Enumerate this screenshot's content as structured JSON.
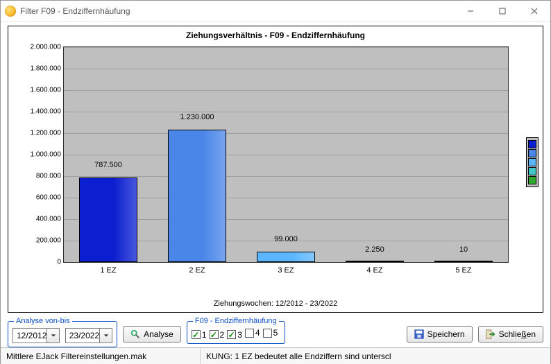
{
  "window": {
    "title": "Filter F09 - Endziffernhäufung"
  },
  "chart_data": {
    "type": "bar",
    "title": "Ziehungsverhältnis  - F09 - Endziffernhäufung",
    "categories": [
      "1 EZ",
      "2 EZ",
      "3 EZ",
      "4 EZ",
      "5 EZ"
    ],
    "values": [
      787500,
      1230000,
      99000,
      2250,
      10
    ],
    "value_labels": [
      "787.500",
      "1.230.000",
      "99.000",
      "2.250",
      "10"
    ],
    "colors": [
      "#0b1fd0",
      "#4a86e8",
      "#5bb6ff",
      "#3fc6c6",
      "#2faa2f"
    ],
    "ylim": [
      0,
      2000000
    ],
    "yticks": [
      0,
      200000,
      400000,
      600000,
      800000,
      1000000,
      1200000,
      1400000,
      1600000,
      1800000,
      2000000
    ],
    "ytick_labels": [
      "0",
      "200.000",
      "400.000",
      "600.000",
      "800.000",
      "1.000.000",
      "1.200.000",
      "1.400.000",
      "1.600.000",
      "1.800.000",
      "2.000.000"
    ],
    "x_subtitle": "Ziehungswochen: 12/2012  - 23/2022",
    "legend_colors": [
      "#0b1fd0",
      "#4a86e8",
      "#5bb6ff",
      "#3fc6c6",
      "#2faa2f"
    ]
  },
  "controls": {
    "analyse_group_label": "Analyse von-bis",
    "from_value": "12/2012",
    "to_value": "23/2022",
    "analyse_button": "Analyse",
    "filter_group_label": "F09 - Endziffernhäufung",
    "checkboxes": [
      {
        "label": "1",
        "checked": true
      },
      {
        "label": "2",
        "checked": true
      },
      {
        "label": "3",
        "checked": true
      },
      {
        "label": "4",
        "checked": false
      },
      {
        "label": "5",
        "checked": false
      }
    ],
    "save_button": "Speichern",
    "close_button_prefix": "Schlie",
    "close_button_underline": "ß",
    "close_button_suffix": "en"
  },
  "statusbar": {
    "left": "Mittlere EJack Filtereinstellungen.mak",
    "right": "KUNG: 1 EZ bedeutet alle Endziffern sind unterscl"
  }
}
